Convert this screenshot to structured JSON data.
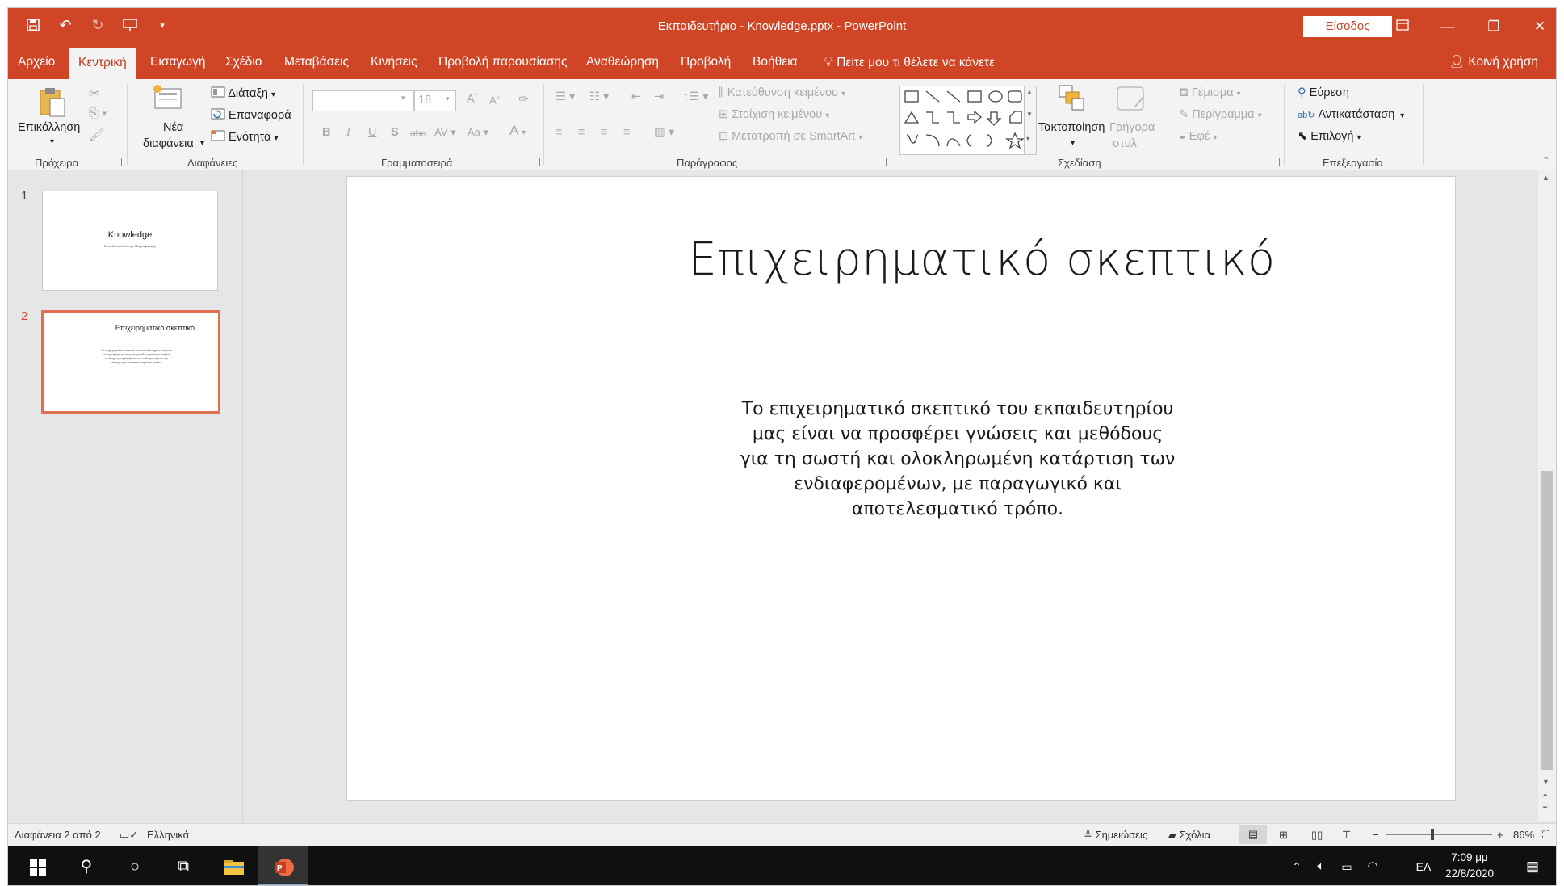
{
  "window": {
    "title": "Εκπαιδευτήριο - Knowledge.pptx  -  PowerPoint",
    "signin": "Είσοδος"
  },
  "tabs": [
    "Αρχείο",
    "Κεντρική",
    "Εισαγωγή",
    "Σχέδιο",
    "Μεταβάσεις",
    "Κινήσεις",
    "Προβολή παρουσίασης",
    "Αναθεώρηση",
    "Προβολή",
    "Βοήθεια"
  ],
  "tellme": "Πείτε μου τι θέλετε να κάνετε",
  "share": "Κοινή χρήση",
  "ribbon": {
    "paste": "Επικόλληση",
    "new_slide_1": "Νέα",
    "new_slide_2": "διαφάνεια",
    "layout": "Διάταξη",
    "reset": "Επαναφορά",
    "section": "Ενότητα",
    "font_size": "18",
    "text_direction": "Κατεύθυνση κειμένου",
    "align_text": "Στοίχιση κειμένου",
    "smartart": "Μετατροπή σε SmartArt",
    "arrange": "Τακτοποίηση",
    "quick_styles_1": "Γρήγορα",
    "quick_styles_2": "στυλ",
    "fill": "Γέμισμα",
    "outline": "Περίγραμμα",
    "effects": "Εφέ",
    "find": "Εύρεση",
    "replace": "Αντικατάσταση",
    "select": "Επιλογή",
    "groups": {
      "clipboard": "Πρόχειρο",
      "slides": "Διαφάνειες",
      "font": "Γραμματοσειρά",
      "paragraph": "Παράγραφος",
      "drawing": "Σχεδίαση",
      "editing": "Επεξεργασία"
    }
  },
  "thumbnails": [
    {
      "num": "1",
      "title": "Knowledge",
      "subtitle": "Εκπαιδευτικό Κέντρο Πληροφορικής"
    },
    {
      "num": "2",
      "title": "Επιχειρηματικό σκεπτικό",
      "body": "Το επιχειρηματικό σκεπτικό του εκπαιδευτηρίου μας είναι να προσφέρει γνώσεις και μεθόδους για τη σωστή και ολοκληρωμένη κατάρτιση των ενδιαφερομένων, με παραγωγικό και αποτελεσματικό τρόπο."
    }
  ],
  "slide": {
    "title": "Επιχειρηματικό σκεπτικό",
    "body_lines": [
      "Το επιχειρηματικό σκεπτικό του εκπαιδευτηρίου",
      "μας είναι να προσφέρει γνώσεις και μεθόδους",
      "για τη σωστή και ολοκληρωμένη κατάρτιση των",
      "ενδιαφερομένων, με παραγωγικό και",
      "αποτελεσματικό τρόπο."
    ]
  },
  "status": {
    "slide_info": "Διαφάνεια 2 από 2",
    "language": "Ελληνικά",
    "notes": "Σημειώσεις",
    "comments": "Σχόλια",
    "zoom": "86%"
  },
  "taskbar": {
    "lang": "ΕΛ",
    "time": "7:09 μμ",
    "date": "22/8/2020"
  }
}
